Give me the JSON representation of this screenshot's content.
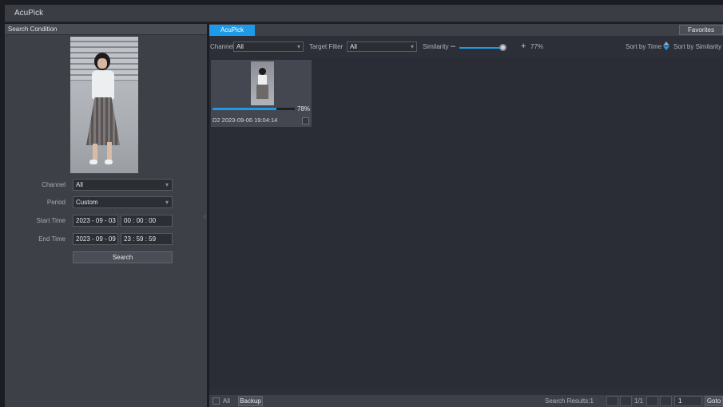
{
  "window": {
    "title": "AcuPick"
  },
  "left_panel": {
    "header": "Search Condition",
    "form": {
      "channel": {
        "label": "Channel",
        "value": "All"
      },
      "period": {
        "label": "Period",
        "value": "Custom"
      },
      "start_time": {
        "label": "Start Time",
        "date": "2023 - 09 - 03",
        "time": "00 : 00 : 00"
      },
      "end_time": {
        "label": "End Time",
        "date": "2023 - 09 - 09",
        "time": "23 : 59 : 59"
      }
    },
    "search_button": "Search"
  },
  "right_panel": {
    "tab": "AcuPick",
    "favorites_button": "Favorites",
    "filters": {
      "channel_label": "Channel",
      "channel_value": "All",
      "target_label": "Target Filter",
      "target_value": "All",
      "similarity_label": "Similarity",
      "similarity_minus": "–",
      "similarity_plus": "+",
      "similarity_value": "77%",
      "similarity_fraction": 0.77,
      "sort_time": "Sort by Time",
      "sort_similarity": "Sort by Similarity"
    },
    "results": [
      {
        "match": "78%",
        "match_fraction": 0.78,
        "label": "D2 2023-09-06 19:04:14"
      }
    ],
    "bottom": {
      "all_label": "All",
      "backup_button": "Backup",
      "search_results": "Search Results:1",
      "page_indicator": "1/1",
      "page_input": "1",
      "goto_button": "Goto"
    }
  },
  "colors": {
    "accent": "#1d9ae8",
    "panel": "#3d4047",
    "background": "#2a2d36"
  }
}
